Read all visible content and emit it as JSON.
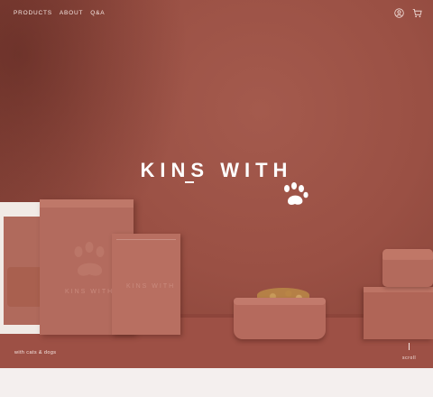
{
  "nav": {
    "links": [
      "PRODUCTS",
      "ABOUT",
      "Q&A"
    ],
    "icons": [
      "account-icon",
      "cart-icon"
    ]
  },
  "hero": {
    "brand": "KINS WITH",
    "tagline": "with cats & dogs",
    "scroll_label": "scroll",
    "box_label": "KINS WITH"
  },
  "colors": {
    "background": "#9a5044",
    "accent_text": "#ffffff",
    "product": "#b36b5e"
  }
}
